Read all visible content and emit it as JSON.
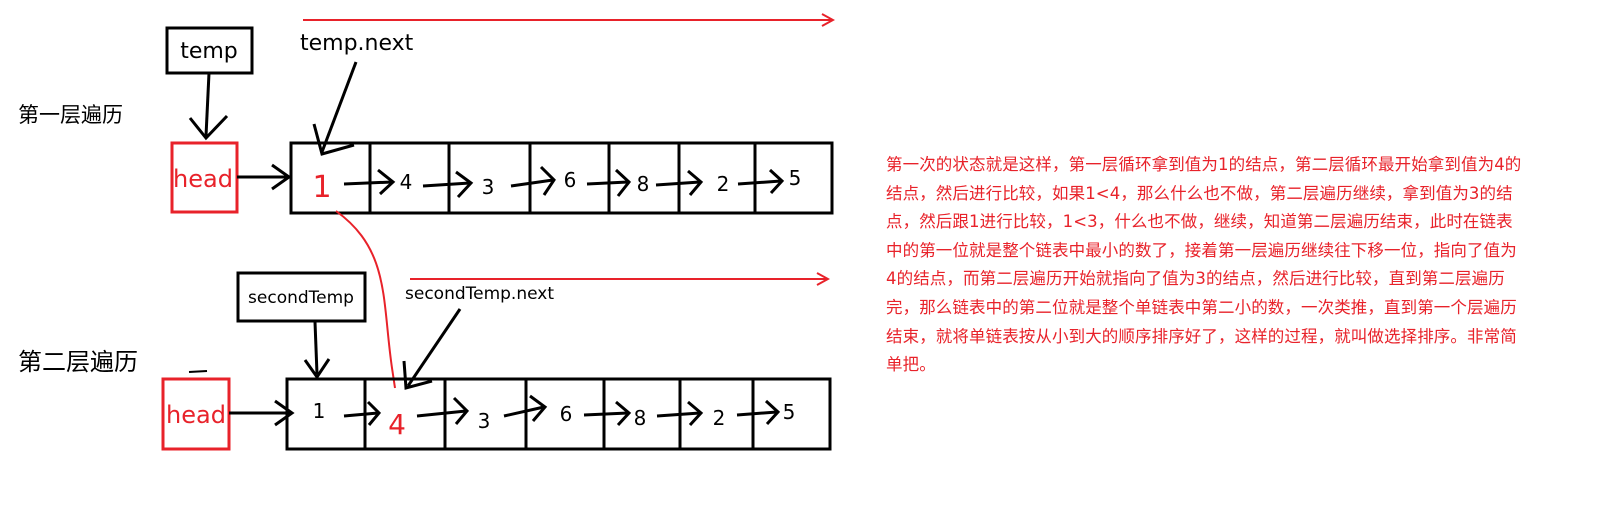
{
  "labels": {
    "pass1": "第一层遍历",
    "pass2": "第二层遍历",
    "temp": "temp",
    "temp_next": "temp.next",
    "second_temp": "secondTemp",
    "second_temp_next": "secondTemp.next",
    "head1": "head",
    "head2": "head"
  },
  "row1_values": [
    "1",
    "4",
    "3",
    "6",
    "8",
    "2",
    "5"
  ],
  "row2_values": [
    "1",
    "4",
    "3",
    "6",
    "8",
    "2",
    "5"
  ],
  "colors": {
    "black": "#000000",
    "red": "#e8222a"
  },
  "explanation": "第一次的状态就是这样，第一层循环拿到值为1的结点，第二层循环最开始拿到值为4的结点，然后进行比较，如果1<4，那么什么也不做，第二层遍历继续，拿到值为3的结点，然后跟1进行比较，1<3，什么也不做，继续，知道第二层遍历结束，此时在链表中的第一位就是整个链表中最小的数了，接着第一层遍历继续往下移一位，指向了值为4的结点，而第二层遍历开始就指向了值为3的结点，然后进行比较，直到第二层遍历完，那么链表中的第二位就是整个单链表中第二小的数，一次类推，直到第一个层遍历结束，就将单链表按从小到大的顺序排序好了，这样的过程，就叫做选择排序。非常简单把。"
}
